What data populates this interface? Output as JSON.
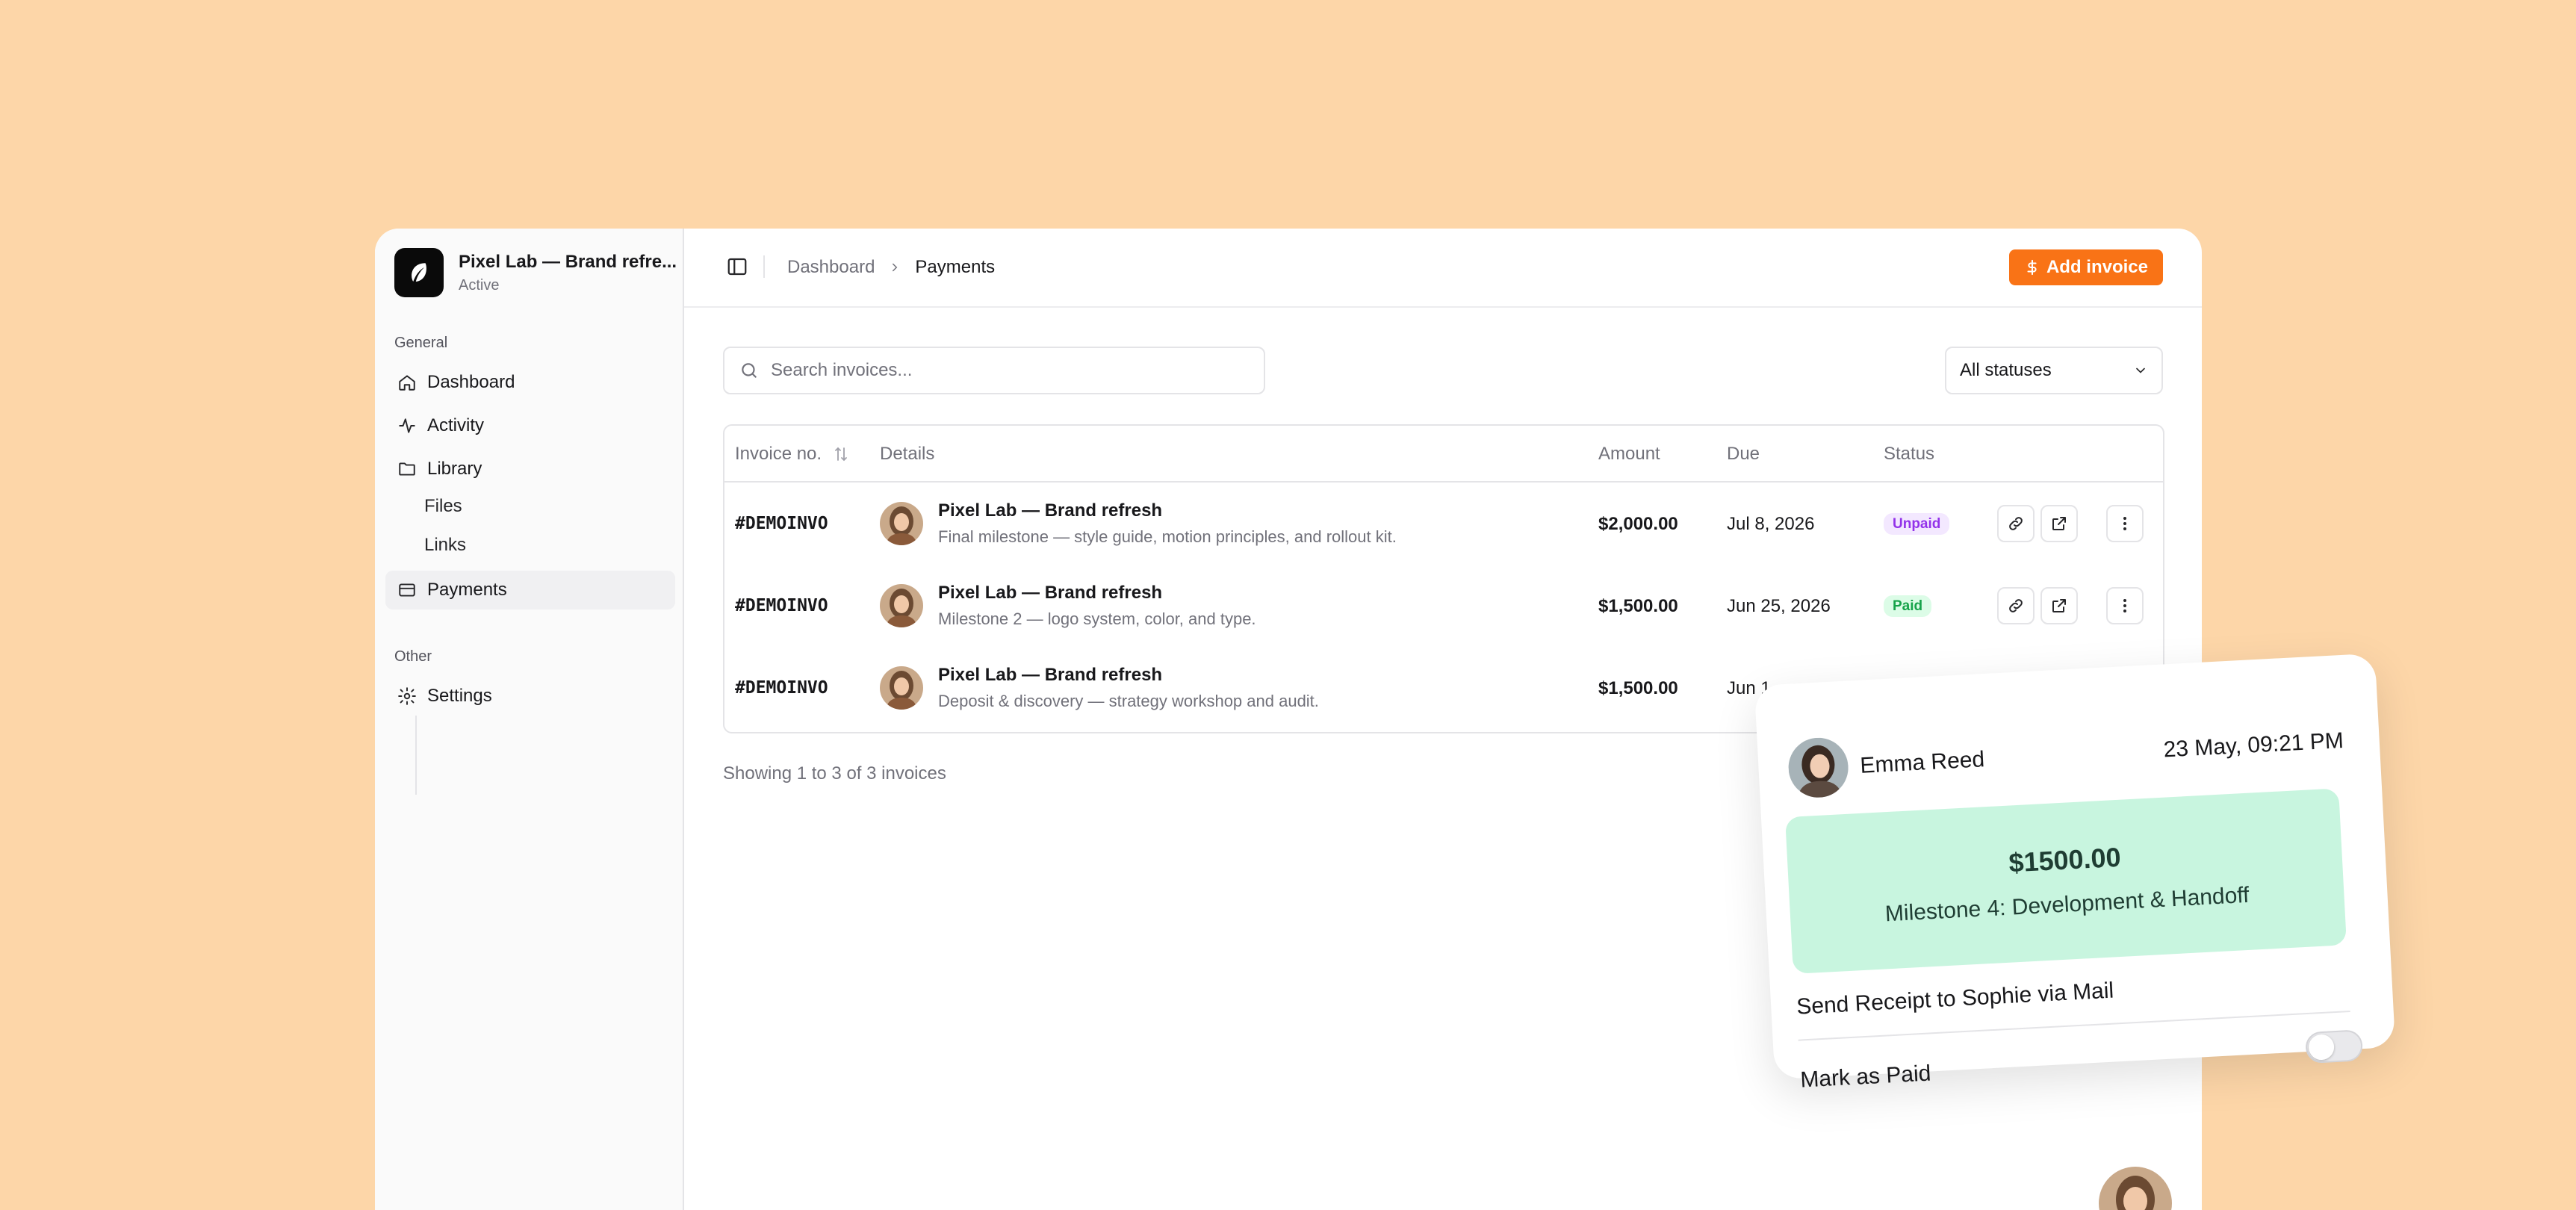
{
  "workspace": {
    "name": "Pixel Lab — Brand refre...",
    "status": "Active"
  },
  "sidebar": {
    "general_label": "General",
    "other_label": "Other",
    "items": [
      {
        "label": "Dashboard",
        "icon": "home-icon"
      },
      {
        "label": "Activity",
        "icon": "activity-icon"
      },
      {
        "label": "Library",
        "icon": "folder-icon"
      },
      {
        "label": "Files"
      },
      {
        "label": "Links"
      },
      {
        "label": "Payments",
        "icon": "credit-card-icon",
        "active": true
      },
      {
        "label": "Settings",
        "icon": "gear-icon"
      }
    ]
  },
  "header": {
    "breadcrumb": [
      "Dashboard",
      "Payments"
    ],
    "add_button": "Add invoice"
  },
  "filters": {
    "search_placeholder": "Search invoices...",
    "status_select": "All statuses"
  },
  "table": {
    "columns": [
      "Invoice no.",
      "Details",
      "Amount",
      "Due",
      "Status"
    ],
    "rows": [
      {
        "invoice_no": "#DEMOINVO",
        "title": "Pixel Lab — Brand refresh",
        "desc": "Final milestone — style guide, motion principles, and rollout kit.",
        "amount": "$2,000.00",
        "due": "Jul 8, 2026",
        "status": "Unpaid"
      },
      {
        "invoice_no": "#DEMOINVO",
        "title": "Pixel Lab — Brand refresh",
        "desc": "Milestone 2 — logo system, color, and type.",
        "amount": "$1,500.00",
        "due": "Jun 25, 2026",
        "status": "Paid"
      },
      {
        "invoice_no": "#DEMOINVO",
        "title": "Pixel Lab — Brand refresh",
        "desc": "Deposit & discovery — strategy workshop and audit.",
        "amount": "$1,500.00",
        "due": "Jun 1",
        "status": ""
      }
    ],
    "footer": "Showing 1 to 3 of 3 invoices"
  },
  "card": {
    "name": "Emma Reed",
    "time": "23 May, 09:21 PM",
    "amount": "$1500.00",
    "milestone": "Milestone 4: Development & Handoff",
    "receipt": "Send Receipt to Sophie via Mail",
    "mark_paid": "Mark as Paid",
    "mark_paid_on": false
  },
  "colors": {
    "accent": "#f97316",
    "background": "#fdd6a8",
    "card_green": "#c8f5df"
  }
}
